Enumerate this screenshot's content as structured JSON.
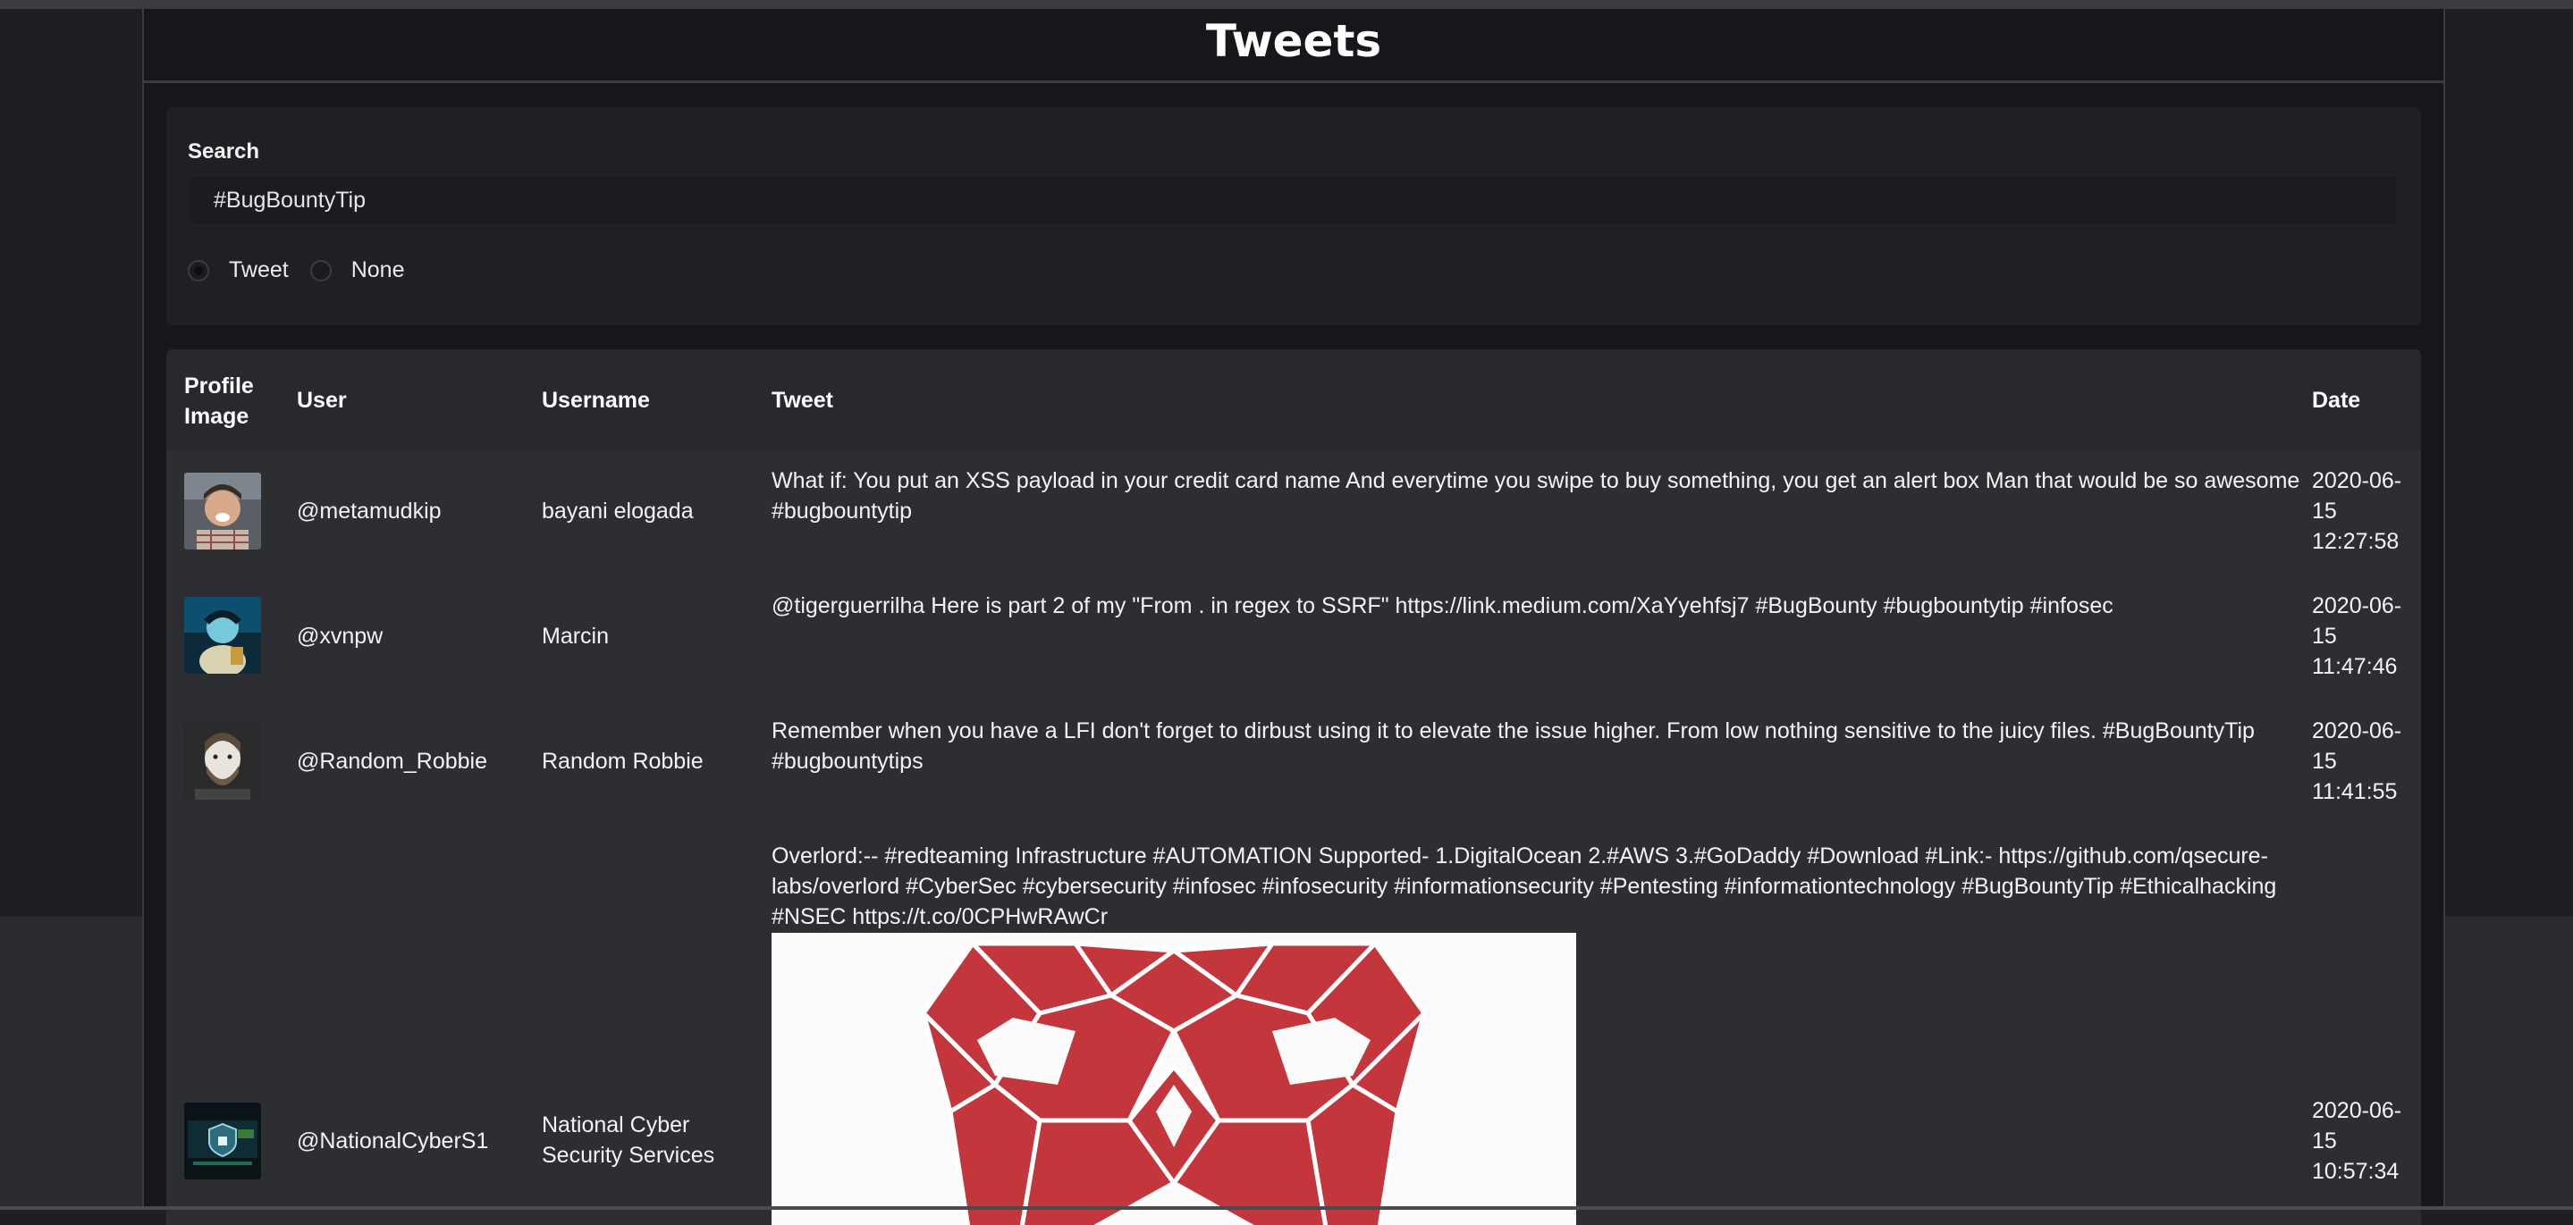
{
  "page": {
    "title": "Tweets"
  },
  "search": {
    "label": "Search",
    "value": "#BugBountyTip",
    "options": [
      {
        "label": "Tweet",
        "checked": true
      },
      {
        "label": "None",
        "checked": false
      }
    ]
  },
  "table": {
    "headers": {
      "profile_image": "Profile Image",
      "user": "User",
      "username": "Username",
      "tweet": "Tweet",
      "date": "Date"
    },
    "rows": [
      {
        "avatar": "avatar-smiling-man-photo",
        "user": "@metamudkip",
        "username": "bayani elogada",
        "tweet": "What if: You put an XSS payload in your credit card name And everytime you swipe to buy something, you get an alert box Man that would be so awesome #bugbountytip",
        "date": "2020-06-15 12:27:58"
      },
      {
        "avatar": "avatar-inverted-color-photo",
        "user": "@xvnpw",
        "username": "Marcin",
        "tweet": "@tigerguerrilha Here is part 2 of my \"From . in regex to SSRF\" https://link.medium.com/XaYyehfsj7 #BugBounty #bugbountytip #infosec",
        "date": "2020-06-15 11:47:46"
      },
      {
        "avatar": "avatar-bearded-man-illustration",
        "user": "@Random_Robbie",
        "username": "Random Robbie",
        "tweet": "Remember when you have a LFI don't forget to dirbust using it to elevate the issue higher. From low nothing sensitive to the juicy files. #BugBountyTip #bugbountytips",
        "date": "2020-06-15 11:41:55"
      },
      {
        "avatar": "avatar-shield-logo",
        "user": "@NationalCyberS1",
        "username": "National Cyber Security Services",
        "tweet": "Overlord:-- #redteaming Infrastructure #AUTOMATION Supported- 1.DigitalOcean 2.#AWS 3.#GoDaddy #Download #Link:- https://github.com/qsecure-labs/overlord #CyberSec #cybersecurity #infosec #infosecurity #informationsecurity #Pentesting #informationtechnology #BugBountyTip #Ethicalhacking #NSEC https://t.co/0CPHwRAwCr",
        "date": "2020-06-15 10:57:34",
        "media": "red-geometric-skull-image"
      }
    ]
  }
}
